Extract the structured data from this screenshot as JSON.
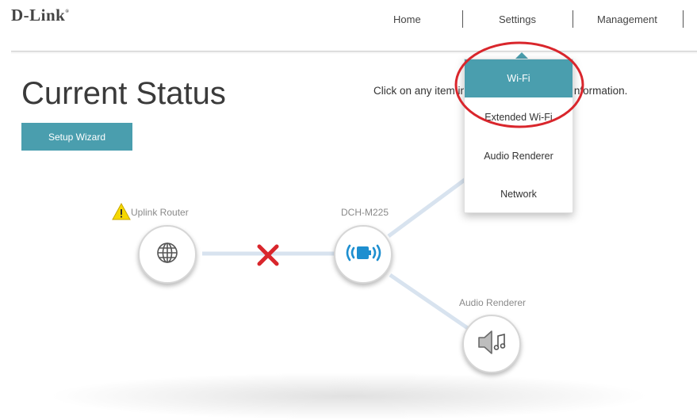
{
  "brand": {
    "logo_text": "D-Link"
  },
  "nav": {
    "items": [
      {
        "label": "Home"
      },
      {
        "label": "Settings"
      },
      {
        "label": "Management"
      }
    ]
  },
  "page": {
    "title": "Current Status",
    "hint_text": "Click on any item in the diagram for more information.",
    "setup_wizard_label": "Setup Wizard"
  },
  "settings_menu": {
    "items": [
      {
        "label": "Wi-Fi",
        "active": true
      },
      {
        "label": "Extended Wi-Fi",
        "active": false
      },
      {
        "label": "Audio Renderer",
        "active": false
      },
      {
        "label": "Network",
        "active": false
      }
    ]
  },
  "diagram": {
    "nodes": [
      {
        "label": "Uplink Router",
        "icon": "globe-icon",
        "status": "warning"
      },
      {
        "label": "DCH-M225",
        "icon": "wifi-extender-icon"
      },
      {
        "label": "Audio Renderer",
        "icon": "speaker-icon"
      }
    ],
    "uplink_connection": "disconnected"
  },
  "colors": {
    "accent": "#4a9eae",
    "link_line": "#d8e3ef",
    "error_x": "#d9262c",
    "warning": "#f5d800",
    "annotation": "#d9262c"
  }
}
